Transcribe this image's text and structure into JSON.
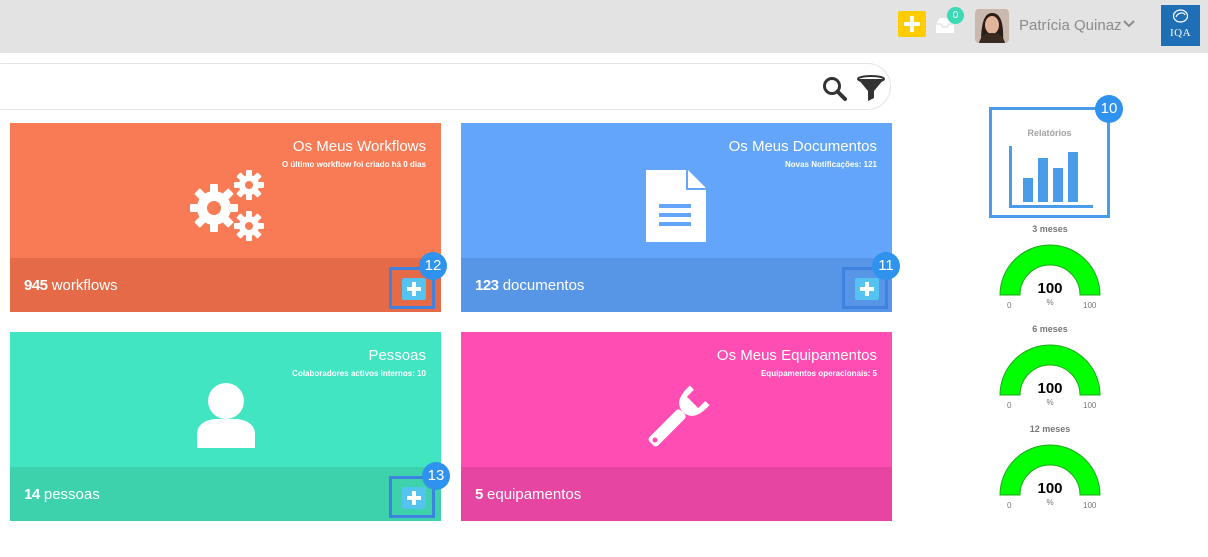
{
  "header": {
    "notifications_count": "0",
    "user_name": "Patrícia Quinaz",
    "logo_text": "IQA",
    "colors": {
      "bar": "#e3e3e3",
      "add": "#ffcc00",
      "badge": "#3dd9b5",
      "logo": "#1f6fb6"
    }
  },
  "search": {
    "value": "",
    "placeholder": ""
  },
  "cards": {
    "workflows": {
      "title": "Os Meus Workflows",
      "subtitle": "O último workflow foi criado há 0 dias",
      "count": "945",
      "unit": "workflows",
      "badge": "12",
      "icon": "gears-icon",
      "color_top": "#f97b55",
      "color_bottom": "#e46a48"
    },
    "documents": {
      "title": "Os Meus Documentos",
      "subtitle": "Novas Notificações: 121",
      "count": "123",
      "unit": "documentos",
      "badge": "11",
      "icon": "document-icon",
      "color_top": "#62a5fa",
      "color_bottom": "#5795e6"
    },
    "people": {
      "title": "Pessoas",
      "subtitle": "Colaboradores activos internos: 10",
      "count": "14",
      "unit": "pessoas",
      "badge": "13",
      "icon": "person-icon",
      "color_top": "#42e5c2",
      "color_bottom": "#3dd1ac"
    },
    "equipment": {
      "title": "Os Meus Equipamentos",
      "subtitle": "Equipamentos operacionais: 5",
      "count": "5",
      "unit": "equipamentos",
      "icon": "wrench-icon",
      "color_top": "#ff4db4",
      "color_bottom": "#e645a1"
    }
  },
  "sidebar": {
    "reports_label": "Relatórios",
    "reports_badge": "10",
    "reports_icon": "bar-chart-icon",
    "gauges": [
      {
        "label": "3 meses",
        "value": "100",
        "unit": "%",
        "min": "0",
        "max": "100",
        "color": "#00ff00"
      },
      {
        "label": "6 meses",
        "value": "100",
        "unit": "%",
        "min": "0",
        "max": "100",
        "color": "#00ff00"
      },
      {
        "label": "12 meses",
        "value": "100",
        "unit": "%",
        "min": "0",
        "max": "100",
        "color": "#00ff00"
      }
    ]
  }
}
